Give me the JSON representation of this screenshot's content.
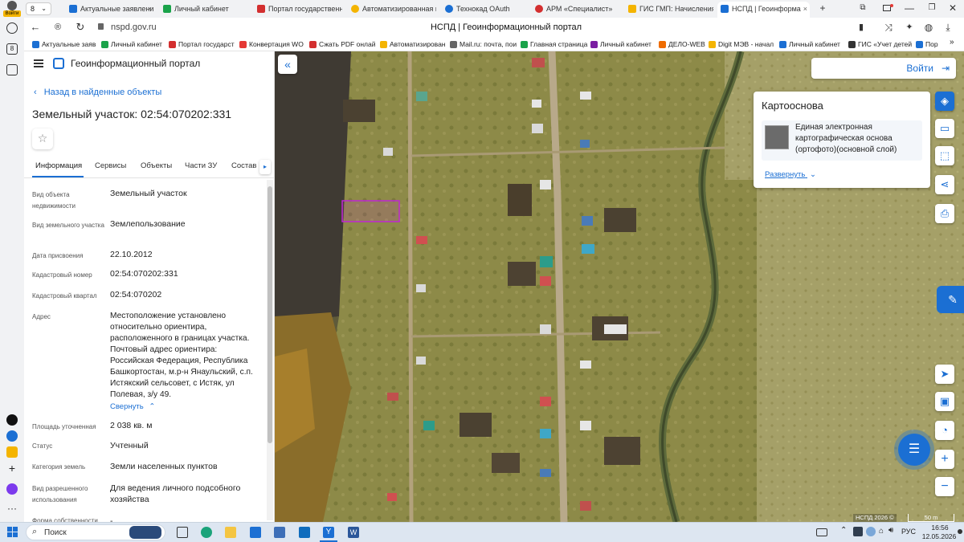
{
  "tabs": [
    {
      "label": "Актуальные заявлени",
      "color": "#1b6fd3"
    },
    {
      "label": "Личный кабинет",
      "color": "#1aa34a"
    },
    {
      "label": "Портал государственн",
      "color": "#d32f2f"
    },
    {
      "label": "Автоматизированная и",
      "color": "#f4b400"
    },
    {
      "label": "Технокад OAuth",
      "color": "#1b6fd3"
    },
    {
      "label": "АРМ «Специалист»",
      "color": "#d32f2f"
    },
    {
      "label": "ГИС ГМП: Начисления",
      "color": "#f4b400"
    },
    {
      "label": "НСПД | Геоинформа",
      "color": "#1b6fd3"
    }
  ],
  "profile": {
    "badge": "Войти",
    "counter": "8"
  },
  "address": {
    "url": "nspd.gov.ru",
    "title": "НСПД | Геоинформационный портал"
  },
  "bookmarks": [
    {
      "label": "Актуальные заяв",
      "color": "#1b6fd3"
    },
    {
      "label": "Личный кабинет",
      "color": "#1aa34a"
    },
    {
      "label": "Портал государст",
      "color": "#d32f2f"
    },
    {
      "label": "Конвертация WO",
      "color": "#e53935"
    },
    {
      "label": "Сжать PDF онлай",
      "color": "#d32f2f"
    },
    {
      "label": "Автоматизирован",
      "color": "#f4b400"
    },
    {
      "label": "Mail.ru: почта, пои",
      "color": "#666666"
    },
    {
      "label": "Главная страница",
      "color": "#1aa34a"
    },
    {
      "label": "Личный кабинет",
      "color": "#7b1fa2"
    },
    {
      "label": "ДЕЛО-WEB",
      "color": "#ef6c00"
    },
    {
      "label": "Digit МЭВ - начал",
      "color": "#f4b400"
    },
    {
      "label": "Личный кабинет",
      "color": "#1b6fd3"
    },
    {
      "label": "ГИС «Учет детей",
      "color": "#333333"
    },
    {
      "label": "Пор",
      "color": "#1b6fd3"
    }
  ],
  "portal": {
    "title": "Геоинформационный портал",
    "back_label": "Назад в найденные объекты",
    "object_title": "Земельный участок: 02:54:070202:331",
    "tabs": [
      "Информация",
      "Сервисы",
      "Объекты",
      "Части ЗУ",
      "Состав"
    ],
    "collapse_label": "Свернуть",
    "properties": [
      {
        "label": "Вид объекта недвижимости",
        "value": "Земельный участок"
      },
      {
        "label": "Вид земельного участка",
        "value": "Землепользование"
      },
      {
        "label": "Дата присвоения",
        "value": "22.10.2012"
      },
      {
        "label": "Кадастровый номер",
        "value": "02:54:070202:331"
      },
      {
        "label": "Кадастровый квартал",
        "value": "02:54:070202"
      },
      {
        "label": "Адрес",
        "value": "Местоположение установлено относительно ориентира, расположенного в границах участка. Почтовый адрес ориентира: Российская Федерация, Республика Башкортостан, м.р-н Янаульский, с.п. Истякский сельсовет, с Истяк, ул Полевая, з/у 49."
      },
      {
        "label": "Площадь уточненная",
        "value": "2 038 кв. м"
      },
      {
        "label": "Статус",
        "value": "Учтенный"
      },
      {
        "label": "Категория земель",
        "value": "Земли населенных пунктов"
      },
      {
        "label": "Вид разрешенного использования",
        "value": "Для ведения личного подсобного хозяйства"
      },
      {
        "label": "Форма собственности",
        "value": "-"
      }
    ]
  },
  "map": {
    "login_label": "Войти",
    "basemap_title": "Картооснова",
    "basemap_layer": "Единая электронная картографическая основа (ортофото)(основной слой)",
    "expand_label": "Развернуть",
    "attribution": "НСПД 2026 ©",
    "scale_label": "50 m",
    "parcel_color": "#c026d3"
  },
  "taskbar": {
    "search_placeholder": "Поиск",
    "lang": "РУС",
    "time": "16:56",
    "date": "12.05.2026"
  }
}
